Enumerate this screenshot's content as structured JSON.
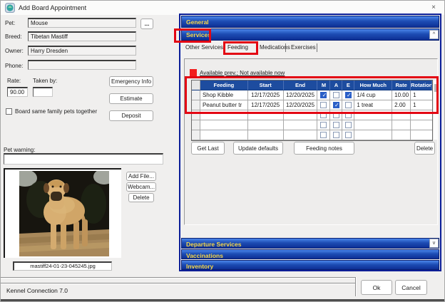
{
  "window": {
    "title": "Add Board Appointment",
    "close_glyph": "×",
    "status_text": "Kennel Connection 7.0",
    "ok_label": "Ok",
    "cancel_label": "Cancel"
  },
  "form": {
    "fields": [
      {
        "label": "Pet:",
        "value": "Mouse"
      },
      {
        "label": "Breed:",
        "value": "Tibetan Mastiff"
      },
      {
        "label": "Owner:",
        "value": "Harry Dresden"
      },
      {
        "label": "Phone:",
        "value": ""
      }
    ],
    "browse_label": "...",
    "rate_label": "Rate:",
    "rate_value": "90.00",
    "taken_by_label": "Taken by:",
    "taken_by_value": "",
    "emergency_button": "Emergency Info",
    "estimate_button": "Estimate",
    "deposit_button": "Deposit",
    "board_checkbox_label": "Board same family pets together",
    "pet_warning_label": "Pet warning:",
    "pet_warning_value": "",
    "photo_caption": "mastiff24-01-23-045245.jpg",
    "add_file_button": "Add File...",
    "webcam_button": "Webcam...",
    "delete_photo_button": "Delete"
  },
  "panel": {
    "sections": {
      "general": "General",
      "services": "Services",
      "departure": "Departure Services",
      "vaccinations": "Vaccinations",
      "inventory": "Inventory"
    },
    "scroll_up_glyph": "^",
    "scroll_down_glyph": "v",
    "tabs": [
      {
        "label": "Other Services"
      },
      {
        "label": "Feeding"
      },
      {
        "label": "Medications"
      },
      {
        "label": "Exercises"
      }
    ],
    "legend_text": "Available prev.; Not available now",
    "table": {
      "headers": [
        "Feeding",
        "Start",
        "End",
        "M",
        "A",
        "E",
        "How Much",
        "Rate",
        "Rotation"
      ],
      "rows": [
        {
          "feeding": "Shop Kibble",
          "start": "12/17/2025",
          "end": "12/20/2025",
          "m": true,
          "a": false,
          "e": true,
          "how_much": "1/4 cup",
          "rate": "10.00",
          "rotation": "1"
        },
        {
          "feeding": "Peanut butter tr",
          "start": "12/17/2025",
          "end": "12/20/2025",
          "m": false,
          "a": true,
          "e": false,
          "how_much": "1 treat",
          "rate": "2.00",
          "rotation": "1"
        },
        {
          "feeding": "",
          "start": "",
          "end": "",
          "m": false,
          "a": false,
          "e": false,
          "how_much": "",
          "rate": "",
          "rotation": ""
        },
        {
          "feeding": "",
          "start": "",
          "end": "",
          "m": false,
          "a": false,
          "e": false,
          "how_much": "",
          "rate": "",
          "rotation": ""
        },
        {
          "feeding": "",
          "start": "",
          "end": "",
          "m": false,
          "a": false,
          "e": false,
          "how_much": "",
          "rate": "",
          "rotation": ""
        }
      ]
    },
    "get_last_button": "Get Last",
    "update_defaults_button": "Update defaults",
    "feeding_notes_button": "Feeding notes",
    "delete_row_button": "Delete"
  },
  "colors": {
    "annotation_red": "#e30613",
    "grid_header_blue": "#1d4c9f",
    "accordion_gold": "#f8d848",
    "accordion_blue": "#1d4db4",
    "legend_red": "#f21d1d",
    "checkbox_blue": "#2b5fc7"
  }
}
